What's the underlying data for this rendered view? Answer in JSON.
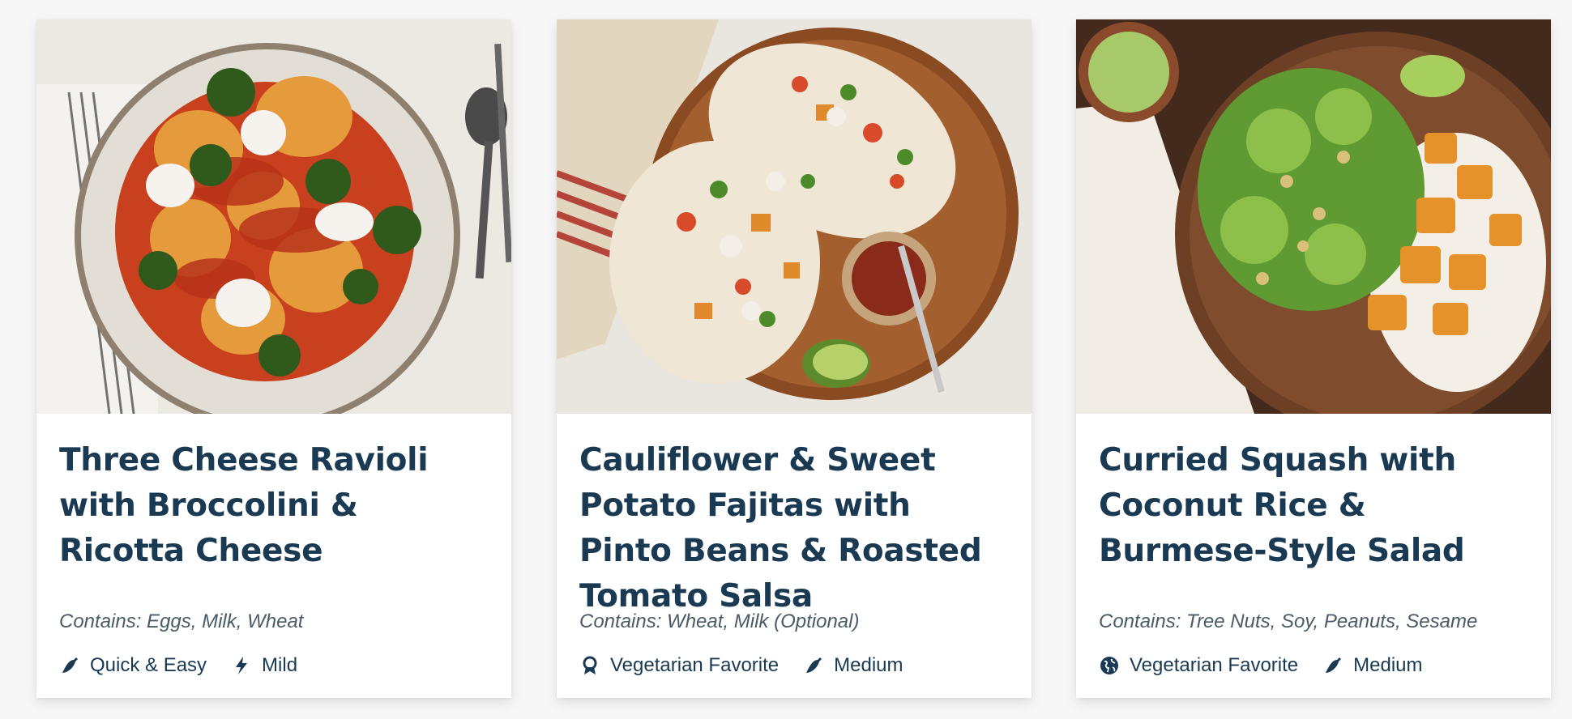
{
  "recipes": [
    {
      "title": "Three Cheese Ravioli with Broccolini & Ricotta Cheese",
      "contains": "Contains: Eggs, Milk, Wheat",
      "tags": [
        {
          "icon": "chili-pepper-icon",
          "label": "Quick & Easy"
        },
        {
          "icon": "lightning-bolt-icon",
          "label": "Mild"
        }
      ],
      "image": {
        "description_icon": "ravioli-dish-photo"
      }
    },
    {
      "title": "Cauliflower & Sweet Potato Fajitas with Pinto Beans & Roasted Tomato Salsa",
      "contains": "Contains: Wheat, Milk (Optional)",
      "tags": [
        {
          "icon": "award-ribbon-icon",
          "label": "Vegetarian Favorite"
        },
        {
          "icon": "chili-pepper-icon",
          "label": "Medium"
        }
      ],
      "image": {
        "description_icon": "fajitas-dish-photo"
      }
    },
    {
      "title": "Curried Squash with Coconut Rice & Burmese-Style Salad",
      "contains": "Contains: Tree Nuts, Soy, Peanuts, Sesame",
      "tags": [
        {
          "icon": "globe-icon",
          "label": "Vegetarian Favorite"
        },
        {
          "icon": "chili-pepper-icon",
          "label": "Medium"
        }
      ],
      "image": {
        "description_icon": "curry-bowl-dish-photo"
      }
    }
  ],
  "colors": {
    "title": "#1a3a53",
    "body_text": "#4a5a68",
    "card_bg": "#ffffff",
    "page_bg": "#f7f7f7"
  }
}
